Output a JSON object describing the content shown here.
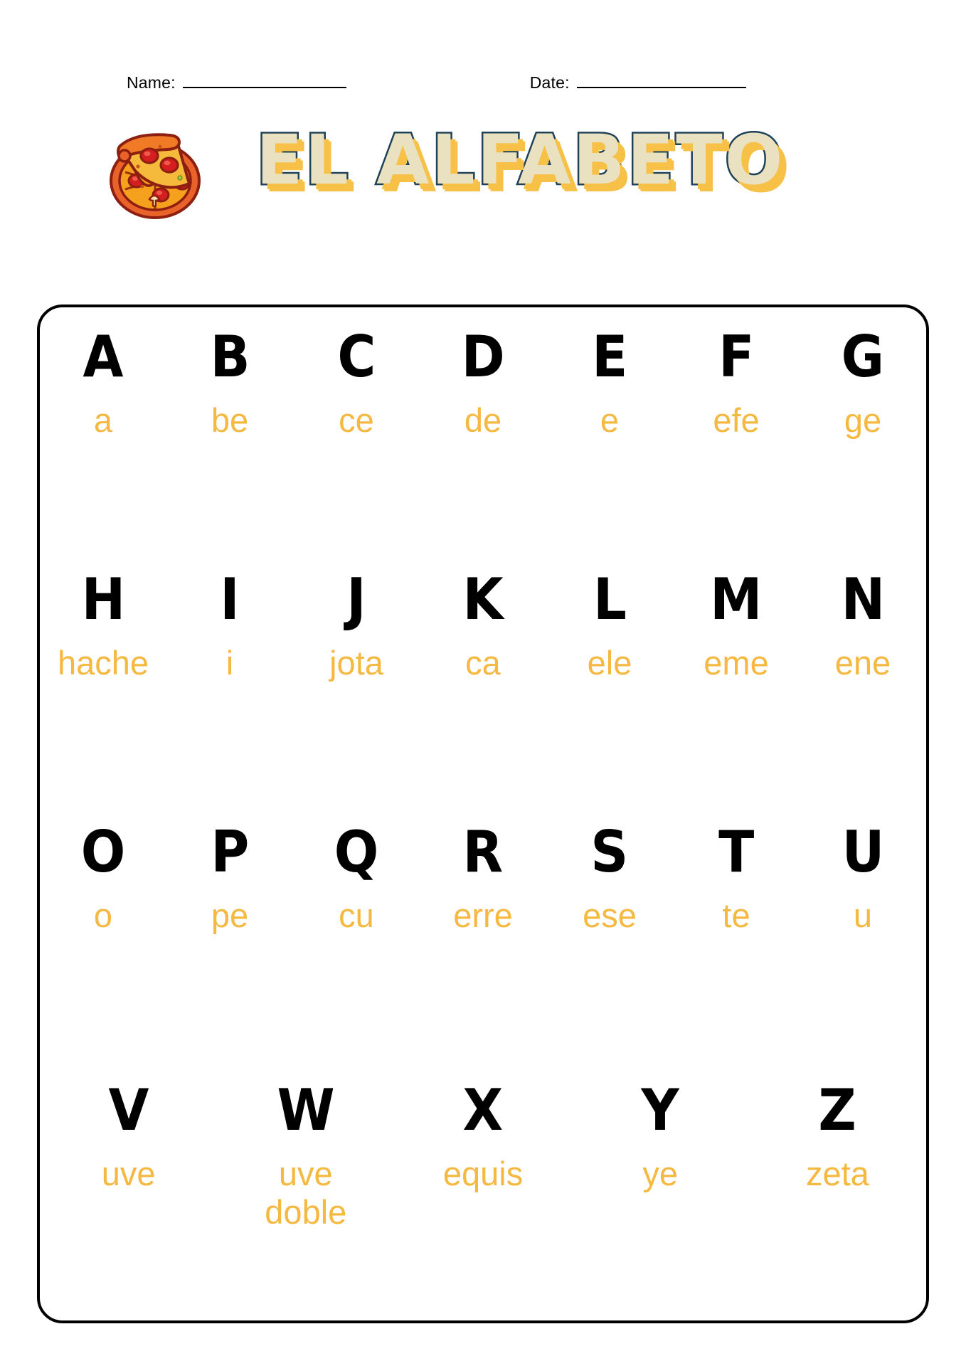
{
  "header": {
    "name_label": "Name:",
    "date_label": "Date:",
    "name_value": "",
    "date_value": ""
  },
  "title": {
    "text": "EL ALFABETO",
    "icon": "pizza-icon",
    "fill_color": "#E9E1C0",
    "outline_color": "#1F4257",
    "shadow_color": "#F7C046"
  },
  "colors": {
    "letter": "#000000",
    "letter_name": "#F5B942",
    "border": "#000000",
    "page": "#FFFFFF"
  },
  "alphabet": {
    "rows": [
      [
        {
          "letter": "A",
          "name": "a"
        },
        {
          "letter": "B",
          "name": "be"
        },
        {
          "letter": "C",
          "name": "ce"
        },
        {
          "letter": "D",
          "name": "de"
        },
        {
          "letter": "E",
          "name": "e"
        },
        {
          "letter": "F",
          "name": "efe"
        },
        {
          "letter": "G",
          "name": "ge"
        }
      ],
      [
        {
          "letter": "H",
          "name": "hache"
        },
        {
          "letter": "I",
          "name": "i"
        },
        {
          "letter": "J",
          "name": "jota"
        },
        {
          "letter": "K",
          "name": "ca"
        },
        {
          "letter": "L",
          "name": "ele"
        },
        {
          "letter": "M",
          "name": "eme"
        },
        {
          "letter": "N",
          "name": "ene"
        }
      ],
      [
        {
          "letter": "O",
          "name": "o"
        },
        {
          "letter": "P",
          "name": "pe"
        },
        {
          "letter": "Q",
          "name": "cu"
        },
        {
          "letter": "R",
          "name": "erre"
        },
        {
          "letter": "S",
          "name": "ese"
        },
        {
          "letter": "T",
          "name": "te"
        },
        {
          "letter": "U",
          "name": "u"
        }
      ],
      [
        {
          "letter": "V",
          "name": "uve"
        },
        {
          "letter": "W",
          "name": "uve\ndoble"
        },
        {
          "letter": "X",
          "name": "equis"
        },
        {
          "letter": "Y",
          "name": "ye"
        },
        {
          "letter": "Z",
          "name": "zeta"
        }
      ]
    ]
  }
}
